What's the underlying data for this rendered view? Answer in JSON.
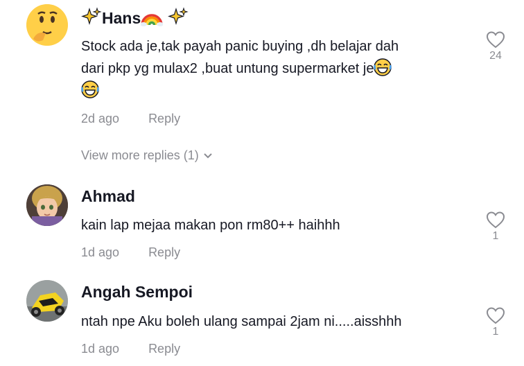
{
  "comments": [
    {
      "username": "Hans",
      "text_line1": "Stock ada je,tak payah panic buying ,dh belajar dah",
      "text_line2": "dari pkp yg mulax2 ,buat untung supermarket je",
      "time": "2d ago",
      "reply_label": "Reply",
      "likes": "24",
      "avatar_icon": "thinking-face-emoji-icon"
    },
    {
      "username": "Ahmad",
      "text": "kain lap mejaa makan pon rm80++ haihhh",
      "time": "1d ago",
      "reply_label": "Reply",
      "likes": "1"
    },
    {
      "username": "Angah Sempoi",
      "text": "ntah npe Aku boleh ulang sampai 2jam ni.....aisshhh",
      "time": "1d ago",
      "reply_label": "Reply",
      "likes": "1"
    }
  ],
  "view_more_replies": "View more replies (1)",
  "colors": {
    "text_primary": "#161823",
    "text_secondary": "#8a8b91"
  }
}
